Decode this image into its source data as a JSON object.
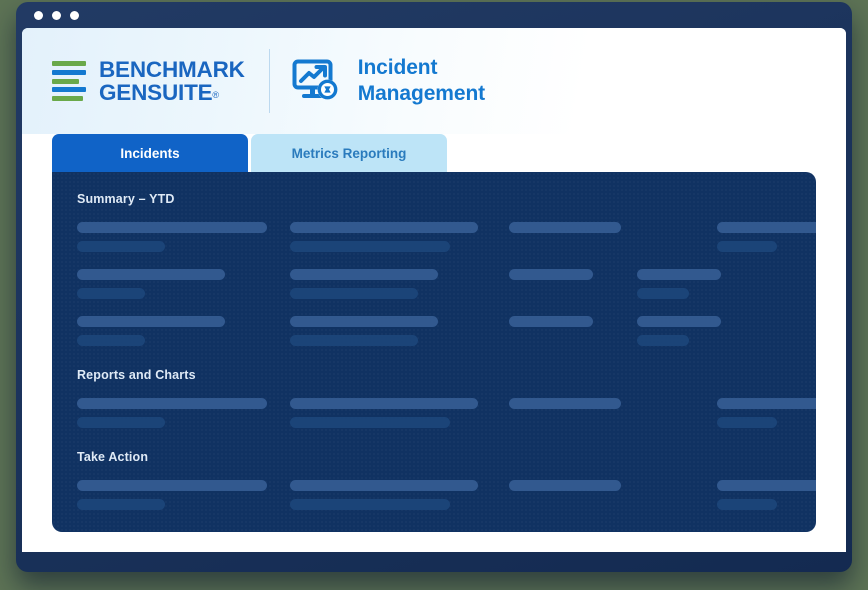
{
  "window": {
    "dots": [
      "close",
      "minimize",
      "maximize"
    ],
    "frame_color": "#16305c",
    "page_background": "#ffffff",
    "desktop_background": "#5d7355"
  },
  "header": {
    "logo": {
      "name": "benchmark-gensuite-logo",
      "line1": "BENCHMARK",
      "line2": "GENSUITE",
      "registered_mark": "®",
      "text_color": "#1a66c0",
      "mark_colors": {
        "green": "#6aa94a",
        "blue": "#1479d0"
      },
      "mark_bars": [
        {
          "color": "green",
          "width": "100%"
        },
        {
          "color": "blue",
          "width": "100%"
        },
        {
          "color": "green",
          "width": "80%"
        },
        {
          "color": "blue",
          "width": "100%"
        },
        {
          "color": "green",
          "width": "92%"
        }
      ]
    },
    "module": {
      "icon_name": "incident-management-monitor-icon",
      "title_line1": "Incident",
      "title_line2": "Management",
      "title_color": "#1479d0"
    }
  },
  "tabs": {
    "active_index": 0,
    "items": [
      {
        "label": "Incidents",
        "active": true,
        "bg": "#1063c7",
        "fg": "#ffffff"
      },
      {
        "label": "Metrics Reporting",
        "active": false,
        "bg": "#bde4f7",
        "fg": "#2a7bbd"
      }
    ]
  },
  "panel": {
    "background": "#103262",
    "bar_colors": {
      "primary": "#32598f",
      "secondary": "#1b4478"
    },
    "sections": [
      {
        "title": "Summary – YTD",
        "rows": [
          {
            "cells": [
              {
                "primary": 190,
                "secondary": 88
              },
              {
                "primary": 188,
                "secondary": 160
              },
              {
                "primary": 112,
                "secondary": 0
              },
              {
                "primary": 115,
                "secondary": 60
              }
            ]
          },
          {
            "cells": [
              {
                "primary": 148,
                "secondary": 68
              },
              {
                "primary": 148,
                "secondary": 128
              },
              {
                "primary": 84,
                "secondary": 0
              },
              {
                "primary": 0,
                "secondary": 0,
                "offset": 80,
                "primary_w": 84,
                "secondary_w": 52
              }
            ]
          },
          {
            "cells": [
              {
                "primary": 148,
                "secondary": 68
              },
              {
                "primary": 148,
                "secondary": 128
              },
              {
                "primary": 84,
                "secondary": 0
              },
              {
                "primary": 0,
                "secondary": 0,
                "offset": 80,
                "primary_w": 84,
                "secondary_w": 52
              }
            ]
          }
        ]
      },
      {
        "title": "Reports and Charts",
        "rows": [
          {
            "cells": [
              {
                "primary": 190,
                "secondary": 88
              },
              {
                "primary": 188,
                "secondary": 160
              },
              {
                "primary": 112,
                "secondary": 0
              },
              {
                "primary": 115,
                "secondary": 60
              }
            ]
          }
        ]
      },
      {
        "title": "Take Action",
        "rows": [
          {
            "cells": [
              {
                "primary": 190,
                "secondary": 88
              },
              {
                "primary": 188,
                "secondary": 160
              },
              {
                "primary": 112,
                "secondary": 0
              },
              {
                "primary": 115,
                "secondary": 60
              }
            ]
          }
        ]
      }
    ]
  }
}
